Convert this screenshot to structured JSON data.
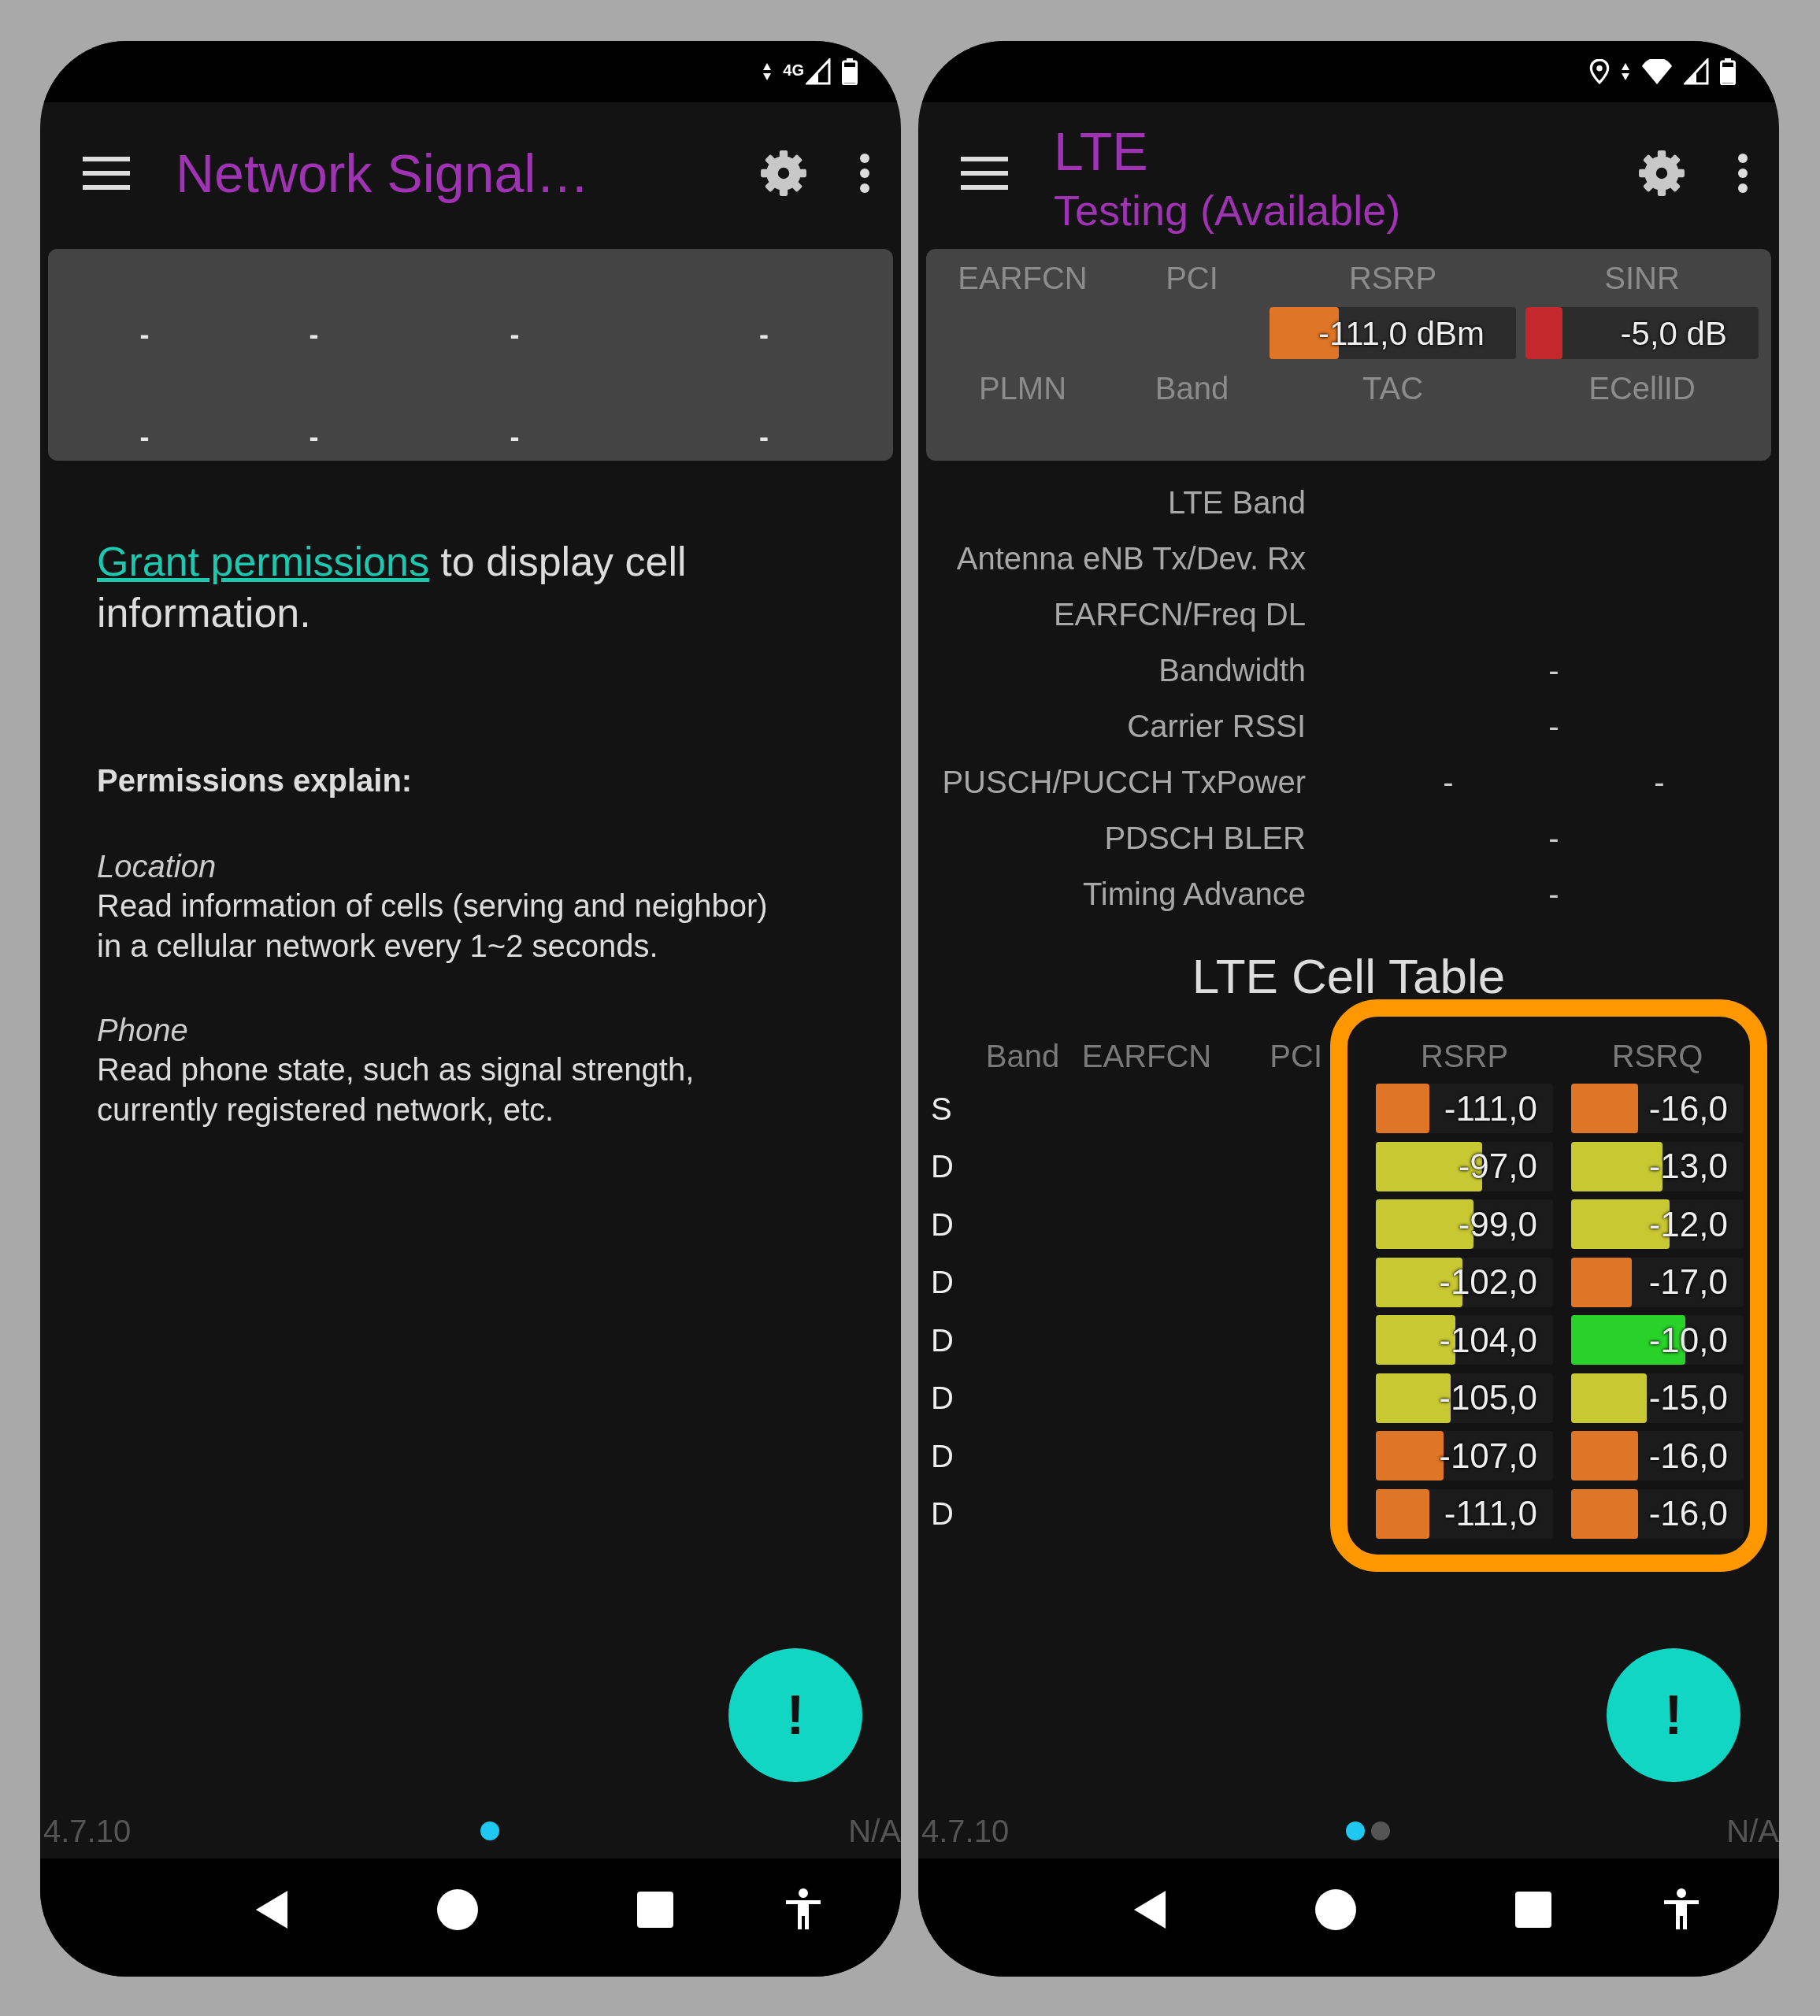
{
  "screens": [
    {
      "kind": "permissions",
      "status_bar": {
        "network_type": "4G",
        "location_on": false,
        "wifi_connected": false
      },
      "app_bar": {
        "title": "Network Signal…"
      },
      "summary_panel": {
        "kind": "empty",
        "rows": [
          {
            "kind": "value",
            "cells": [
              "-",
              "-",
              "-",
              "-"
            ]
          },
          {
            "kind": "value",
            "cells": [
              "-",
              "-",
              "-",
              "-"
            ]
          }
        ]
      },
      "message": {
        "link": "Grant permissions",
        "text": " to display cell information."
      },
      "permissions": {
        "heading": "Permissions explain:",
        "items": [
          {
            "name": "Location",
            "description": "Read information of cells (serving and neighbor) in a cellular network every 1~2 seconds."
          },
          {
            "name": "Phone",
            "description": "Read phone state, such as signal strength, currently registered network, etc."
          }
        ]
      },
      "fab": {
        "label": "!"
      },
      "footer": {
        "version": "4.7.10",
        "pages": [
          {
            "selected": true
          }
        ],
        "network": "N/A"
      }
    },
    {
      "kind": "lte",
      "status_bar": {
        "location_on": true,
        "wifi_connected": true
      },
      "app_bar": {
        "title": "LTE",
        "subtitle": "Testing (Available)"
      },
      "summary_panel": {
        "kind": "serving",
        "rows": [
          {
            "kind": "header",
            "cells": [
              "EARFCN",
              "PCI",
              "RSRP",
              "SINR"
            ]
          },
          {
            "kind": "bars",
            "bars": [
              {
                "text": "-111,0 dBm",
                "level": 0.28,
                "color": "#df7526"
              },
              {
                "text": "-5,0 dB",
                "level": 0.16,
                "color": "#c4282c"
              }
            ]
          },
          {
            "kind": "header",
            "cells": [
              "PLMN",
              "Band",
              "TAC",
              "ECellID"
            ]
          }
        ]
      },
      "details": [
        {
          "label": "LTE Band"
        },
        {
          "label": "Antenna eNB Tx/Dev. Rx"
        },
        {
          "label": "EARFCN/Freq DL"
        },
        {
          "label": "Bandwidth",
          "values": [
            "-"
          ]
        },
        {
          "label": "Carrier RSSI",
          "values": [
            "-"
          ]
        },
        {
          "label": "PUSCH/PUCCH TxPower",
          "values": [
            "-",
            "-"
          ]
        },
        {
          "label": "PDSCH BLER",
          "values": [
            "-"
          ]
        },
        {
          "label": "Timing Advance",
          "values": [
            "-"
          ]
        }
      ],
      "cell_table": {
        "title": "LTE Cell Table",
        "columns": [
          "Band",
          "EARFCN",
          "PCI",
          "RSRP",
          "RSRQ"
        ],
        "highlighted": true,
        "rows": [
          {
            "type": "S",
            "rsrp": {
              "text": "-111,0",
              "level": 0.3,
              "color": "#df7526"
            },
            "rsrq": {
              "text": "-16,0",
              "level": 0.39,
              "color": "#df7526"
            }
          },
          {
            "type": "D",
            "rsrp": {
              "text": "-97,0",
              "level": 0.6,
              "color": "#c8c832"
            },
            "rsrq": {
              "text": "-13,0",
              "level": 0.53,
              "color": "#c8c832"
            }
          },
          {
            "type": "D",
            "rsrp": {
              "text": "-99,0",
              "level": 0.55,
              "color": "#c8c832"
            },
            "rsrq": {
              "text": "-12,0",
              "level": 0.57,
              "color": "#c8c832"
            }
          },
          {
            "type": "D",
            "rsrp": {
              "text": "-102,0",
              "level": 0.49,
              "color": "#c8c832"
            },
            "rsrq": {
              "text": "-17,0",
              "level": 0.35,
              "color": "#df7526"
            }
          },
          {
            "type": "D",
            "rsrp": {
              "text": "-104,0",
              "level": 0.45,
              "color": "#c8c832"
            },
            "rsrq": {
              "text": "-10,0",
              "level": 0.66,
              "color": "#28d228"
            }
          },
          {
            "type": "D",
            "rsrp": {
              "text": "-105,0",
              "level": 0.42,
              "color": "#c8c832"
            },
            "rsrq": {
              "text": "-15,0",
              "level": 0.44,
              "color": "#c8c832"
            }
          },
          {
            "type": "D",
            "rsrp": {
              "text": "-107,0",
              "level": 0.38,
              "color": "#df7526"
            },
            "rsrq": {
              "text": "-16,0",
              "level": 0.39,
              "color": "#df7526"
            }
          },
          {
            "type": "D",
            "rsrp": {
              "text": "-111,0",
              "level": 0.3,
              "color": "#df7526"
            },
            "rsrq": {
              "text": "-16,0",
              "level": 0.39,
              "color": "#df7526"
            }
          }
        ]
      },
      "fab": {
        "label": "!"
      },
      "footer": {
        "version": "4.7.10",
        "pages": [
          {
            "selected": true
          },
          {
            "selected": false
          }
        ],
        "network": "N/A"
      }
    }
  ]
}
